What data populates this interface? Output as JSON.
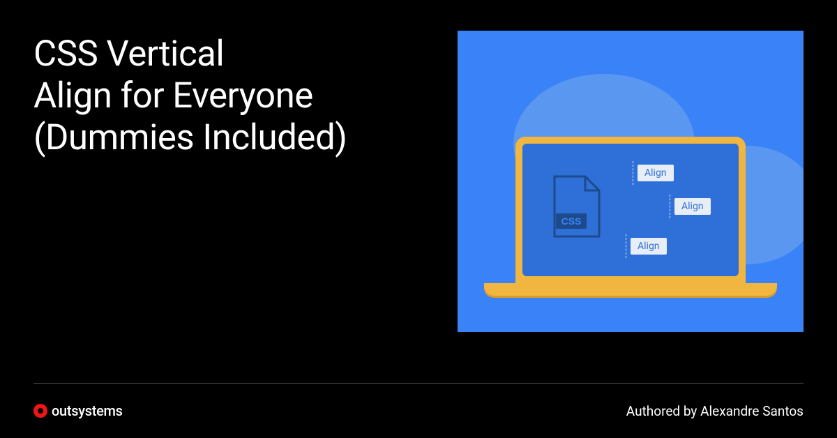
{
  "title": "CSS Vertical\nAlign for Everyone\n(Dummies Included)",
  "illustration": {
    "file_label": "CSS",
    "tags": [
      "Align",
      "Align",
      "Align"
    ]
  },
  "brand": {
    "name": "outsystems"
  },
  "author_line": "Authored by Alexandre Santos"
}
